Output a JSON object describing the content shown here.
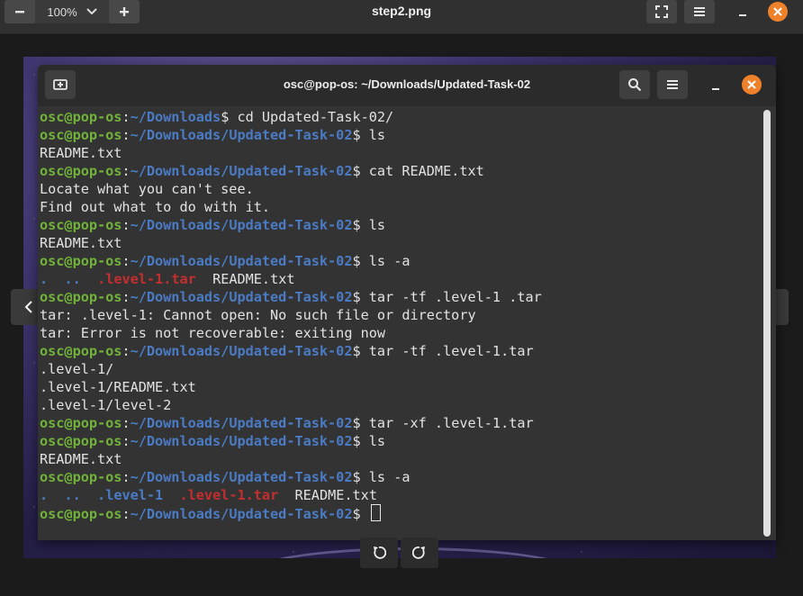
{
  "viewer": {
    "title": "step2.png",
    "zoom": "100%",
    "icons": {
      "zoom_out": "minus-icon",
      "zoom_in": "plus-icon",
      "fullscreen": "fullscreen-icon",
      "menu": "hamburger-menu-icon",
      "minimize": "minimize-icon",
      "close": "close-icon",
      "prev": "chevron-left-icon",
      "next": "chevron-right-icon",
      "rotate_left": "rotate-left-icon",
      "rotate_right": "rotate-right-icon"
    },
    "colors": {
      "close": "#f0812b",
      "header": "#303030"
    }
  },
  "terminal": {
    "title": "osc@pop-os: ~/Downloads/Updated-Task-02",
    "colors": {
      "user": "#71b23a",
      "path": "#4a7bc4",
      "archive": "#c52e2e",
      "text": "#e2e2e2"
    },
    "lines": [
      {
        "user": "osc@pop-os",
        "sep": ":",
        "path": "~/Downloads",
        "cmd": "$ cd Updated-Task-02/"
      },
      {
        "user": "osc@pop-os",
        "sep": ":",
        "path": "~/Downloads/Updated-Task-02",
        "cmd": "$ ls"
      },
      {
        "out": "README.txt"
      },
      {
        "user": "osc@pop-os",
        "sep": ":",
        "path": "~/Downloads/Updated-Task-02",
        "cmd": "$ cat README.txt"
      },
      {
        "out": "Locate what you can't see."
      },
      {
        "out": "Find out what to do with it."
      },
      {
        "user": "osc@pop-os",
        "sep": ":",
        "path": "~/Downloads/Updated-Task-02",
        "cmd": "$ ls"
      },
      {
        "out": "README.txt"
      },
      {
        "user": "osc@pop-os",
        "sep": ":",
        "path": "~/Downloads/Updated-Task-02",
        "cmd": "$ ls -a"
      },
      {
        "listing": [
          {
            "t": ".",
            "k": "blue"
          },
          {
            "t": "  ",
            "k": "c"
          },
          {
            "t": "..",
            "k": "blue"
          },
          {
            "t": "  ",
            "k": "c"
          },
          {
            "t": ".level-1.tar",
            "k": "red"
          },
          {
            "t": "  README.txt",
            "k": "c"
          }
        ]
      },
      {
        "user": "osc@pop-os",
        "sep": ":",
        "path": "~/Downloads/Updated-Task-02",
        "cmd": "$ tar -tf .level-1 .tar"
      },
      {
        "out": "tar: .level-1: Cannot open: No such file or directory"
      },
      {
        "out": "tar: Error is not recoverable: exiting now"
      },
      {
        "user": "osc@pop-os",
        "sep": ":",
        "path": "~/Downloads/Updated-Task-02",
        "cmd": "$ tar -tf .level-1.tar"
      },
      {
        "out": ".level-1/"
      },
      {
        "out": ".level-1/README.txt"
      },
      {
        "out": ".level-1/level-2"
      },
      {
        "user": "osc@pop-os",
        "sep": ":",
        "path": "~/Downloads/Updated-Task-02",
        "cmd": "$ tar -xf .level-1.tar"
      },
      {
        "user": "osc@pop-os",
        "sep": ":",
        "path": "~/Downloads/Updated-Task-02",
        "cmd": "$ ls"
      },
      {
        "out": "README.txt"
      },
      {
        "user": "osc@pop-os",
        "sep": ":",
        "path": "~/Downloads/Updated-Task-02",
        "cmd": "$ ls -a"
      },
      {
        "listing": [
          {
            "t": ".",
            "k": "blue"
          },
          {
            "t": "  ",
            "k": "c"
          },
          {
            "t": "..",
            "k": "blue"
          },
          {
            "t": "  ",
            "k": "c"
          },
          {
            "t": ".level-1",
            "k": "blue"
          },
          {
            "t": "  ",
            "k": "c"
          },
          {
            "t": ".level-1.tar",
            "k": "red"
          },
          {
            "t": "  README.txt",
            "k": "c"
          }
        ]
      },
      {
        "user": "osc@pop-os",
        "sep": ":",
        "path": "~/Downloads/Updated-Task-02",
        "cmd": "$ ",
        "cursor": true
      }
    ]
  }
}
